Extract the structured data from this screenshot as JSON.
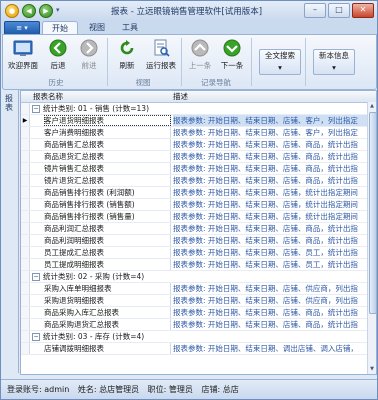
{
  "title": "报表 - 立远眼镜销售管理软件[试用版本]",
  "quick_access": {
    "menu_label": "▾"
  },
  "app_button": {
    "label": "≡ ▾"
  },
  "tabs": [
    {
      "label": "开始",
      "active": true
    },
    {
      "label": "视图",
      "active": false
    },
    {
      "label": "工具",
      "active": false
    }
  ],
  "ribbon": {
    "buttons": [
      {
        "label": "欢迎界面",
        "icon": "home-icon",
        "disabled": false
      },
      {
        "label": "后退",
        "icon": "back-icon",
        "disabled": false
      },
      {
        "label": "前进",
        "icon": "forward-icon",
        "disabled": true
      },
      {
        "label": "刷新",
        "icon": "refresh-icon",
        "disabled": false
      },
      {
        "label": "运行报表",
        "icon": "run-report-icon",
        "disabled": false
      },
      {
        "label": "上一条",
        "icon": "up-icon",
        "disabled": true
      },
      {
        "label": "下一条",
        "icon": "down-icon",
        "disabled": false
      }
    ],
    "dropdowns": [
      {
        "label": "全文搜索"
      },
      {
        "label": "新本信息"
      }
    ],
    "groups": [
      "历史",
      "视图",
      "记录导航"
    ]
  },
  "left_panel": {
    "label": "报表"
  },
  "grid": {
    "columns": [
      "报表名称",
      "描述"
    ],
    "groups": [
      {
        "label": "统计类别: 01 - 销售 (计数=13)",
        "rows": [
          {
            "name": "客户退货明细报表",
            "desc": "报表参数: 开始日期、结束日期、店铺、客户，列出指定",
            "selected": true
          },
          {
            "name": "客户消费明细报表",
            "desc": "报表参数: 开始日期、结束日期、店铺、客户，列出指定"
          },
          {
            "name": "商品销售汇总报表",
            "desc": "报表参数: 开始日期、结束日期、店铺、商品，统计出指"
          },
          {
            "name": "商品退货汇总报表",
            "desc": "报表参数: 开始日期、结束日期、店铺、商品，统计出指"
          },
          {
            "name": "镜片销售汇总报表",
            "desc": "报表参数: 开始日期、结束日期、店铺、商品，统计出指"
          },
          {
            "name": "镜片退货汇总报表",
            "desc": "报表参数: 开始日期、结束日期、店铺、商品，统计出指"
          },
          {
            "name": "商品销售排行报表 (利润额)",
            "desc": "报表参数: 开始日期、结束日期、店铺，统计出指定期间"
          },
          {
            "name": "商品销售排行报表 (销售额)",
            "desc": "报表参数: 开始日期、结束日期、店铺，统计出指定期间"
          },
          {
            "name": "商品销售排行报表 (销售量)",
            "desc": "报表参数: 开始日期、结束日期、店铺，统计出指定期间"
          },
          {
            "name": "商品利润汇总报表",
            "desc": "报表参数: 开始日期、结束日期、店铺、商品，统计出指"
          },
          {
            "name": "商品利润明细报表",
            "desc": "报表参数: 开始日期、结束日期、店铺、商品，统计出指"
          },
          {
            "name": "员工提成汇总报表",
            "desc": "报表参数: 开始日期、结束日期、店铺、员工，统计出指"
          },
          {
            "name": "员工提成明细报表",
            "desc": "报表参数: 开始日期、结束日期、店铺、员工，统计出指"
          }
        ]
      },
      {
        "label": "统计类别: 02 - 采购 (计数=4)",
        "rows": [
          {
            "name": "采购入库单明细报表",
            "desc": "报表参数: 开始日期、结束日期、店铺、供应商，列出指"
          },
          {
            "name": "采购退货明细报表",
            "desc": "报表参数: 开始日期、结束日期、店铺、供应商，列出指"
          },
          {
            "name": "商品采购入库汇总报表",
            "desc": "报表参数: 开始日期、结束日期、店铺、商品，统计出指"
          },
          {
            "name": "商品采购退货汇总报表",
            "desc": "报表参数: 开始日期、结束日期、店铺、商品，统计出指"
          }
        ]
      },
      {
        "label": "统计类别: 03 - 库存 (计数=4)",
        "rows": [
          {
            "name": "店铺调拨明细报表",
            "desc": "报表参数: 开始日期、结束日期、调出店铺、调入店铺，"
          }
        ]
      }
    ]
  },
  "status": {
    "account": "登录账号: admin",
    "name": "姓名: 总店管理员",
    "position": "职位: 管理员",
    "store": "店铺: 总店"
  },
  "colors": {
    "accent": "#1e5cab",
    "link_text": "#2e58a6",
    "selection": "#cfe0f5"
  }
}
